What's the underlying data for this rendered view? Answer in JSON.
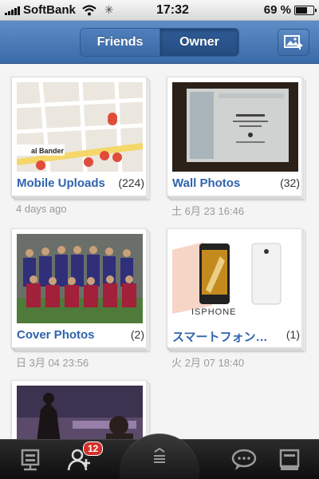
{
  "status_bar": {
    "carrier": "SoftBank",
    "time": "17:32",
    "battery": "69 %",
    "battery_level": 0.69
  },
  "nav": {
    "tabs": [
      "Friends",
      "Owner"
    ],
    "selected": "Owner",
    "upload_icon": "photo-upload-icon"
  },
  "albums": [
    {
      "name": "Mobile Uploads",
      "count": "(224)",
      "date": "4 days ago",
      "map_label": "al Bander"
    },
    {
      "name": "Wall Photos",
      "count": "(32)",
      "date": "土 6月 23 16:46"
    },
    {
      "name": "Cover Photos",
      "count": "(2)",
      "date": "日 3月 04 23:56"
    },
    {
      "name": "スマートフォン…",
      "count": "(1)",
      "date": "火 2月 07 18:40",
      "phone_label": "ISPHONE"
    },
    {
      "name": "",
      "count": "",
      "date": ""
    }
  ],
  "tab_bar": {
    "badge": "12",
    "icons": [
      "news-feed-icon",
      "friend-requests-icon",
      "menu-icon",
      "messages-icon",
      "notifications-icon"
    ]
  },
  "colors": {
    "nav_blue": "#3a6aa8",
    "link_blue": "#2f64ad",
    "badge_red": "#d3312a"
  }
}
